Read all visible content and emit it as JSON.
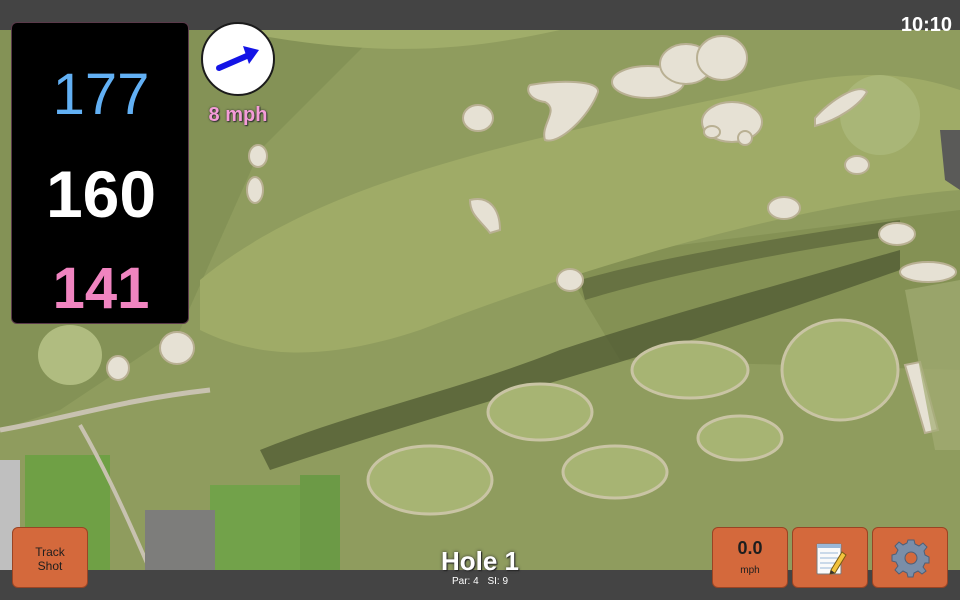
{
  "status_bar": {
    "time": "10:10"
  },
  "distances": {
    "back": "177",
    "middle": "160",
    "front": "141"
  },
  "wind": {
    "speed": "8 mph",
    "arrow_icon": "wind-arrow-icon",
    "arrow_color": "#1414e6"
  },
  "hole": {
    "title": "Hole 1",
    "par": "Par: 4",
    "stroke_index": "SI: 9"
  },
  "buttons": {
    "track_shot_line1": "Track",
    "track_shot_line2": "Shot",
    "speed_value": "0.0",
    "speed_unit": "mph",
    "notes_icon": "notepad-icon",
    "settings_icon": "gear-icon"
  },
  "colors": {
    "back_distance": "#62b0f4",
    "middle_distance": "#ffffff",
    "front_distance": "#f084c0",
    "button_accent": "#d4693c"
  }
}
